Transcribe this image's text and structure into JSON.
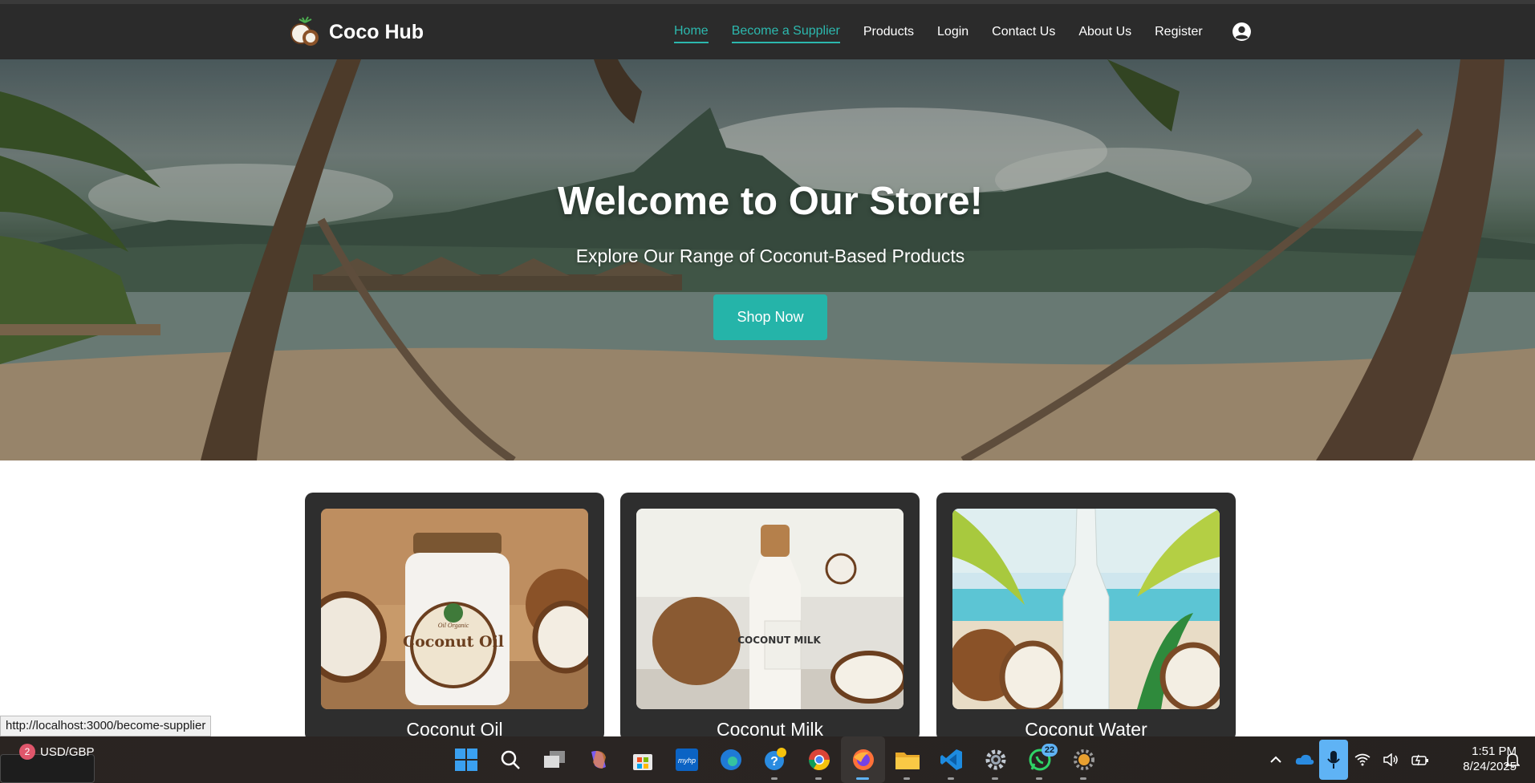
{
  "app": {
    "brand_name": "Coco Hub",
    "accent_color": "#2cb8ae"
  },
  "nav": {
    "links": [
      {
        "label": "Home",
        "active": true
      },
      {
        "label": "Become a Supplier",
        "active": true
      },
      {
        "label": "Products",
        "active": false
      },
      {
        "label": "Login",
        "active": false
      },
      {
        "label": "Contact Us",
        "active": false
      },
      {
        "label": "About Us",
        "active": false
      },
      {
        "label": "Register",
        "active": false
      }
    ],
    "account_icon": "user-circle-icon"
  },
  "hero": {
    "title": "Welcome to Our Store!",
    "subtitle": "Explore Our Range of Coconut-Based Products",
    "button_label": "Shop Now",
    "button_color": "#25b4a9"
  },
  "products": [
    {
      "name": "Coconut Oil",
      "image_label": "Coconut Oil",
      "image_subtext": "Oil Organic"
    },
    {
      "name": "Coconut Milk",
      "image_label": "COCONUT MILK"
    },
    {
      "name": "Coconut Water"
    }
  ],
  "status_bar": {
    "url": "http://localhost:3000/become-supplier"
  },
  "taskbar": {
    "widget_badge": "2",
    "widget_text": "USD/GBP",
    "apps": [
      "windows-start-icon",
      "search-icon",
      "task-view-icon",
      "copilot-icon",
      "microsoft-store-icon",
      "myhp-icon",
      "edge-icon",
      "get-help-icon",
      "chrome-icon",
      "firefox-icon",
      "file-explorer-icon",
      "vscode-icon",
      "settings-icon",
      "whatsapp-icon",
      "gear-app-icon"
    ],
    "whatsapp_count": "22",
    "myhp_label": "myhp",
    "time": "1:51 PM",
    "date": "8/24/2025"
  }
}
